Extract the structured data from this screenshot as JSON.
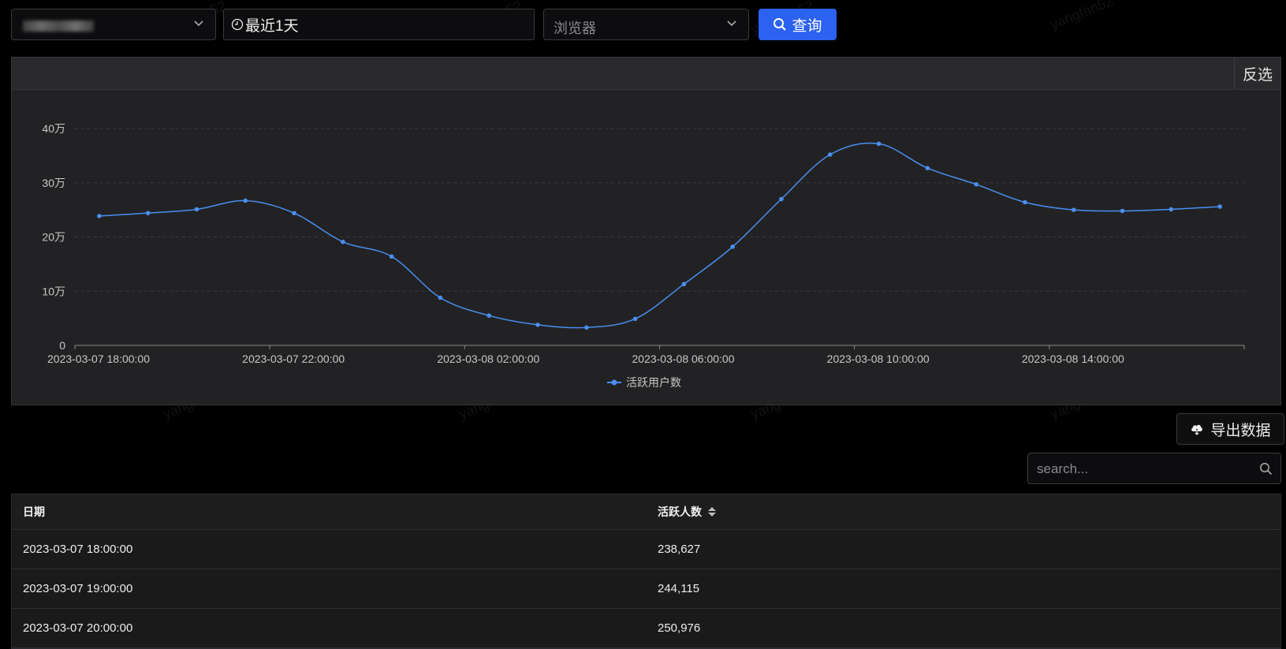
{
  "watermark": "yangfan52",
  "toolbar": {
    "time_range": "最近1天",
    "browser_placeholder": "浏览器",
    "query_label": "查询"
  },
  "panel": {
    "invert_label": "反选"
  },
  "chart_data": {
    "type": "line",
    "x": [
      "2023-03-07 18:00:00",
      "2023-03-07 19:00:00",
      "2023-03-07 20:00:00",
      "2023-03-07 21:00:00",
      "2023-03-07 22:00:00",
      "2023-03-07 23:00:00",
      "2023-03-08 00:00:00",
      "2023-03-08 01:00:00",
      "2023-03-08 02:00:00",
      "2023-03-08 03:00:00",
      "2023-03-08 04:00:00",
      "2023-03-08 05:00:00",
      "2023-03-08 06:00:00",
      "2023-03-08 07:00:00",
      "2023-03-08 08:00:00",
      "2023-03-08 09:00:00",
      "2023-03-08 10:00:00",
      "2023-03-08 11:00:00",
      "2023-03-08 12:00:00",
      "2023-03-08 13:00:00",
      "2023-03-08 14:00:00",
      "2023-03-08 15:00:00",
      "2023-03-08 16:00:00",
      "2023-03-08 17:00:00"
    ],
    "series": [
      {
        "name": "活跃用户数",
        "values": [
          238627,
          244115,
          250976,
          267000,
          244000,
          191000,
          164000,
          88000,
          55000,
          38000,
          33000,
          49000,
          113000,
          182000,
          270000,
          352000,
          372000,
          327000,
          297000,
          264000,
          250000,
          248000,
          251000,
          256000
        ]
      }
    ],
    "x_tick_labels": [
      "2023-03-07 18:00:00",
      "2023-03-07 22:00:00",
      "2023-03-08 02:00:00",
      "2023-03-08 06:00:00",
      "2023-03-08 10:00:00",
      "2023-03-08 14:00:00"
    ],
    "y_tick_labels": [
      "0",
      "10万",
      "20万",
      "30万",
      "40万"
    ],
    "ylim": [
      0,
      400000
    ],
    "grid": true,
    "legend_placement": "bottom-center",
    "line_color": "#4a8ef0"
  },
  "export_label": "导出数据",
  "search_placeholder": "search...",
  "table": {
    "headers": [
      "日期",
      "活跃人数"
    ],
    "rows": [
      [
        "2023-03-07 18:00:00",
        "238,627"
      ],
      [
        "2023-03-07 19:00:00",
        "244,115"
      ],
      [
        "2023-03-07 20:00:00",
        "250,976"
      ]
    ]
  }
}
